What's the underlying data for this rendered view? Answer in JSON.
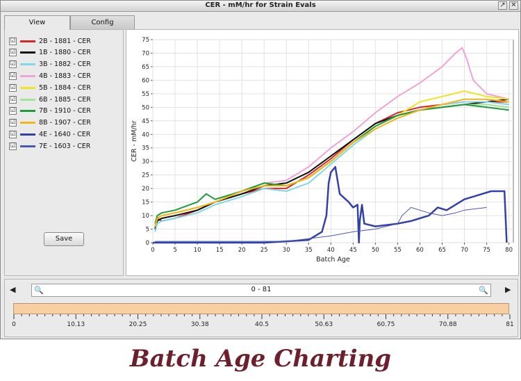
{
  "window": {
    "title": "CER - mM/hr for Strain Evals",
    "btn_restore": "↗",
    "btn_close": "✕"
  },
  "tabs": [
    {
      "label": "View"
    },
    {
      "label": "Config"
    }
  ],
  "legend": [
    {
      "label": "2B - 1881 - CER",
      "color": "#d9262b",
      "checked": "☑"
    },
    {
      "label": "1B - 1880 - CER",
      "color": "#111111",
      "checked": "☑"
    },
    {
      "label": "3B - 1882 - CER",
      "color": "#7fd8e6",
      "checked": "☑"
    },
    {
      "label": "4B - 1883 - CER",
      "color": "#f0a3d4",
      "checked": "☑"
    },
    {
      "label": "5B - 1884 - CER",
      "color": "#f0e424",
      "checked": "☑"
    },
    {
      "label": "6B - 1885 - CER",
      "color": "#a6e39a",
      "checked": "☑"
    },
    {
      "label": "7B - 1910 - CER",
      "color": "#1f9a3a",
      "checked": "☑"
    },
    {
      "label": "8B - 1907 - CER",
      "color": "#f2b51a",
      "checked": "☑"
    },
    {
      "label": "4E - 1640 - CER",
      "color": "#3240a8",
      "checked": "☑"
    },
    {
      "label": "7E - 1603 - CER",
      "color": "#4a57b0",
      "checked": "☑"
    }
  ],
  "save_label": "Save",
  "chart_data": {
    "type": "line",
    "xlabel": "Batch Age",
    "ylabel": "CER - mM/hr",
    "xlim": [
      0,
      81
    ],
    "ylim": [
      0,
      75
    ],
    "x_ticks": [
      "0",
      "5",
      "10",
      "15",
      "20",
      "25",
      "30",
      "35",
      "40",
      "45",
      "50",
      "55",
      "60",
      "65",
      "70",
      "75",
      "80"
    ],
    "y_ticks": [
      "0",
      "5",
      "10",
      "15",
      "20",
      "25",
      "30",
      "35",
      "40",
      "45",
      "50",
      "55",
      "60",
      "65",
      "70",
      "75"
    ],
    "grid": true,
    "series": [
      {
        "name": "2B - 1881 - CER",
        "color": "#d9262b",
        "width": 2,
        "points": [
          [
            0.5,
            5
          ],
          [
            1,
            9
          ],
          [
            2,
            8
          ],
          [
            5,
            9
          ],
          [
            10,
            12
          ],
          [
            14,
            15
          ],
          [
            20,
            18
          ],
          [
            25,
            20
          ],
          [
            30,
            20
          ],
          [
            35,
            25
          ],
          [
            40,
            31
          ],
          [
            45,
            38
          ],
          [
            50,
            44
          ],
          [
            55,
            48
          ],
          [
            60,
            50
          ],
          [
            65,
            51
          ],
          [
            70,
            52
          ],
          [
            75,
            52
          ],
          [
            80,
            52
          ]
        ]
      },
      {
        "name": "1B - 1880 - CER",
        "color": "#111111",
        "width": 2,
        "points": [
          [
            0.5,
            5
          ],
          [
            1,
            8
          ],
          [
            2,
            9
          ],
          [
            5,
            10
          ],
          [
            10,
            12
          ],
          [
            14,
            15
          ],
          [
            20,
            18
          ],
          [
            25,
            21
          ],
          [
            30,
            22
          ],
          [
            35,
            26
          ],
          [
            40,
            32
          ],
          [
            45,
            38
          ],
          [
            50,
            44
          ],
          [
            55,
            47
          ],
          [
            60,
            49
          ],
          [
            65,
            50
          ],
          [
            70,
            51
          ],
          [
            75,
            52
          ],
          [
            80,
            53
          ]
        ]
      },
      {
        "name": "3B - 1882 - CER",
        "color": "#7fd8e6",
        "width": 2,
        "points": [
          [
            0.5,
            4
          ],
          [
            1,
            7
          ],
          [
            2,
            8
          ],
          [
            5,
            9
          ],
          [
            10,
            11
          ],
          [
            14,
            14
          ],
          [
            20,
            17
          ],
          [
            25,
            20
          ],
          [
            30,
            19
          ],
          [
            35,
            22
          ],
          [
            40,
            29
          ],
          [
            45,
            36
          ],
          [
            50,
            42
          ],
          [
            55,
            46
          ],
          [
            60,
            49
          ],
          [
            65,
            51
          ],
          [
            70,
            52
          ],
          [
            75,
            52
          ],
          [
            80,
            51
          ]
        ]
      },
      {
        "name": "4B - 1883 - CER",
        "color": "#f0a3d4",
        "width": 2,
        "points": [
          [
            0.5,
            6
          ],
          [
            1,
            9
          ],
          [
            2,
            10
          ],
          [
            5,
            11
          ],
          [
            10,
            13
          ],
          [
            14,
            15
          ],
          [
            20,
            19
          ],
          [
            25,
            22
          ],
          [
            30,
            23
          ],
          [
            35,
            28
          ],
          [
            40,
            35
          ],
          [
            45,
            41
          ],
          [
            50,
            48
          ],
          [
            55,
            54
          ],
          [
            60,
            59
          ],
          [
            65,
            65
          ],
          [
            68,
            70
          ],
          [
            69.5,
            72
          ],
          [
            70.5,
            68
          ],
          [
            72,
            60
          ],
          [
            75,
            55
          ],
          [
            80,
            53
          ]
        ]
      },
      {
        "name": "5B - 1884 - CER",
        "color": "#f0e424",
        "width": 2,
        "points": [
          [
            0.5,
            6
          ],
          [
            1,
            9
          ],
          [
            2,
            10
          ],
          [
            5,
            11
          ],
          [
            10,
            13
          ],
          [
            14,
            15
          ],
          [
            20,
            19
          ],
          [
            25,
            22
          ],
          [
            30,
            21
          ],
          [
            35,
            24
          ],
          [
            40,
            30
          ],
          [
            45,
            37
          ],
          [
            50,
            43
          ],
          [
            55,
            47
          ],
          [
            60,
            52
          ],
          [
            65,
            54
          ],
          [
            70,
            56
          ],
          [
            75,
            54
          ],
          [
            80,
            53
          ]
        ]
      },
      {
        "name": "6B - 1885 - CER",
        "color": "#a6e39a",
        "width": 2,
        "points": [
          [
            0.5,
            6
          ],
          [
            1,
            9
          ],
          [
            2,
            10
          ],
          [
            5,
            11
          ],
          [
            10,
            13
          ],
          [
            14,
            15
          ],
          [
            20,
            19
          ],
          [
            25,
            22
          ],
          [
            30,
            21
          ],
          [
            35,
            24
          ],
          [
            40,
            30
          ],
          [
            45,
            37
          ],
          [
            50,
            43
          ],
          [
            55,
            47
          ],
          [
            60,
            49
          ],
          [
            65,
            50
          ],
          [
            70,
            51
          ],
          [
            75,
            51
          ],
          [
            80,
            50
          ]
        ]
      },
      {
        "name": "7B - 1910 - CER",
        "color": "#1f9a3a",
        "width": 2,
        "points": [
          [
            0.5,
            7
          ],
          [
            1,
            10
          ],
          [
            2,
            11
          ],
          [
            5,
            12
          ],
          [
            10,
            15
          ],
          [
            12,
            18
          ],
          [
            13,
            17
          ],
          [
            14,
            16
          ],
          [
            20,
            19
          ],
          [
            25,
            22
          ],
          [
            30,
            21
          ],
          [
            35,
            24
          ],
          [
            40,
            30
          ],
          [
            45,
            37
          ],
          [
            50,
            43
          ],
          [
            55,
            47
          ],
          [
            60,
            49
          ],
          [
            65,
            50
          ],
          [
            70,
            51
          ],
          [
            75,
            50
          ],
          [
            80,
            49
          ]
        ]
      },
      {
        "name": "8B - 1907 - CER",
        "color": "#f2b51a",
        "width": 2,
        "points": [
          [
            0.5,
            6
          ],
          [
            1,
            9
          ],
          [
            2,
            10
          ],
          [
            5,
            11
          ],
          [
            10,
            13
          ],
          [
            14,
            15
          ],
          [
            20,
            19
          ],
          [
            25,
            21
          ],
          [
            30,
            21
          ],
          [
            35,
            24
          ],
          [
            40,
            30
          ],
          [
            45,
            37
          ],
          [
            50,
            42
          ],
          [
            55,
            46
          ],
          [
            60,
            49
          ],
          [
            65,
            51
          ],
          [
            70,
            53
          ],
          [
            75,
            53
          ],
          [
            80,
            52
          ]
        ]
      },
      {
        "name": "4E - 1640 - CER",
        "color": "#3240a8",
        "width": 2.5,
        "points": [
          [
            0,
            0
          ],
          [
            25,
            0
          ],
          [
            30,
            0.5
          ],
          [
            35,
            1
          ],
          [
            38,
            4
          ],
          [
            39,
            10
          ],
          [
            39.5,
            22
          ],
          [
            40,
            26
          ],
          [
            41,
            28
          ],
          [
            42,
            18
          ],
          [
            44,
            15
          ],
          [
            45,
            13
          ],
          [
            46,
            14
          ],
          [
            46.3,
            0
          ],
          [
            46.5,
            8
          ],
          [
            47,
            14
          ],
          [
            47.5,
            7
          ],
          [
            50,
            6
          ],
          [
            55,
            7
          ],
          [
            58,
            8
          ],
          [
            60,
            9
          ],
          [
            62,
            10
          ],
          [
            64,
            13
          ],
          [
            66,
            12
          ],
          [
            70,
            16
          ],
          [
            72,
            17
          ],
          [
            74,
            18
          ],
          [
            76,
            19
          ],
          [
            79,
            19
          ],
          [
            79.5,
            0
          ]
        ]
      },
      {
        "name": "7E - 1603 - CER",
        "color": "#4a57b0",
        "width": 1,
        "points": [
          [
            0.5,
            0.5
          ],
          [
            30,
            0.5
          ],
          [
            35,
            1.5
          ],
          [
            40,
            2.5
          ],
          [
            45,
            4
          ],
          [
            50,
            5
          ],
          [
            55,
            7
          ],
          [
            56,
            10
          ],
          [
            58,
            13
          ],
          [
            60,
            12
          ],
          [
            62,
            11
          ],
          [
            65,
            10
          ],
          [
            68,
            11
          ],
          [
            70,
            12
          ],
          [
            75,
            13
          ]
        ]
      }
    ]
  },
  "navigator": {
    "range_text": "0 - 81",
    "left_arrow": "◀",
    "right_arrow": "▶",
    "zoom_out_icon": "🔍",
    "zoom_in_icon": "🔍",
    "tick_labels": [
      "0",
      "10.13",
      "20.25",
      "30.38",
      "40.5",
      "50.63",
      "60.75",
      "70.88",
      "81"
    ]
  },
  "caption": "Batch Age Charting"
}
